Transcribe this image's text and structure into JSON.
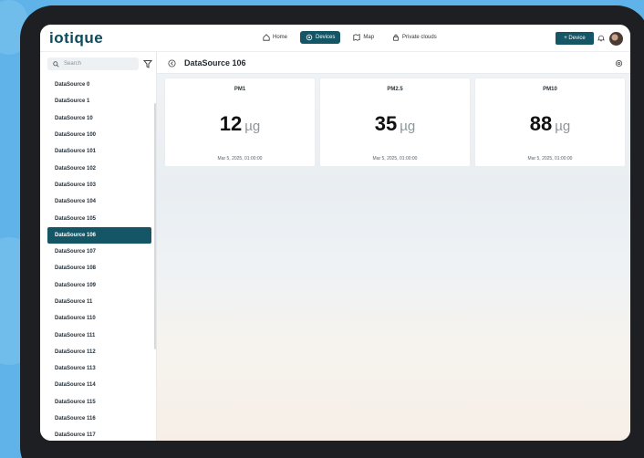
{
  "app": {
    "logo": "iotique"
  },
  "nav": [
    {
      "label": "Home",
      "icon": "home-icon"
    },
    {
      "label": "Devices",
      "icon": "devices-icon",
      "active": true
    },
    {
      "label": "Map",
      "icon": "map-icon"
    },
    {
      "label": "Private clouds",
      "icon": "lock-icon"
    }
  ],
  "topbar": {
    "add_label": "+ Device"
  },
  "sidebar": {
    "search_placeholder": "Search",
    "items": [
      "DataSource 0",
      "DataSource 1",
      "DataSource 10",
      "DataSource 100",
      "DataSource 101",
      "DataSource 102",
      "DataSource 103",
      "DataSource 104",
      "DataSource 105",
      "DataSource 106",
      "DataSource 107",
      "DataSource 108",
      "DataSource 109",
      "DataSource 11",
      "DataSource 110",
      "DataSource 111",
      "DataSource 112",
      "DataSource 113",
      "DataSource 114",
      "DataSource 115",
      "DataSource 116",
      "DataSource 117"
    ],
    "active_index": 9
  },
  "main": {
    "title": "DataSource 106",
    "cards": [
      {
        "label": "PM1",
        "value": "12",
        "unit": "µg",
        "timestamp": "Mar 5, 2025, 01:00:00"
      },
      {
        "label": "PM2.5",
        "value": "35",
        "unit": "µg",
        "timestamp": "Mar 5, 2025, 01:00:00"
      },
      {
        "label": "PM10",
        "value": "88",
        "unit": "µg",
        "timestamp": "Mar 5, 2025, 01:00:00"
      }
    ]
  },
  "colors": {
    "primary": "#145566",
    "background": "#5fb3e8",
    "device_frame": "#1d1f22"
  }
}
